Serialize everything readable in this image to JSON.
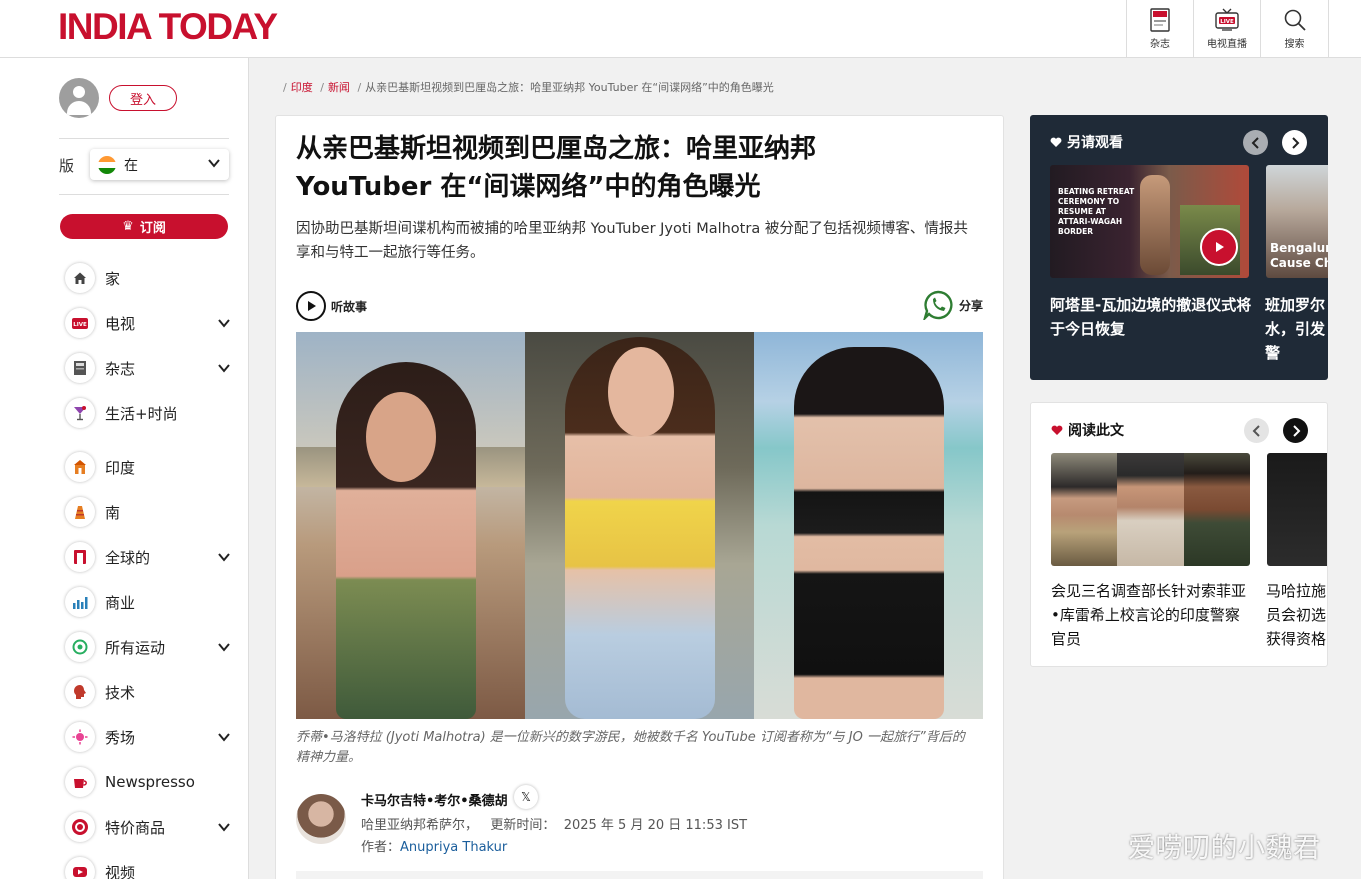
{
  "header": {
    "logo": "INDIA TODAY",
    "buttons": [
      {
        "label": "杂志",
        "icon": "magazine-icon"
      },
      {
        "label": "电视直播",
        "icon": "live-tv-icon"
      },
      {
        "label": "搜索",
        "icon": "search-icon"
      }
    ],
    "magazine_icon_text": "INDIA TODAY",
    "live_badge": "LIVE"
  },
  "sidebar": {
    "login_label": "登入",
    "edition_label": "版",
    "edition_value": "在",
    "subscribe_label": "订阅",
    "nav": [
      {
        "label": "家",
        "icon": "home-icon",
        "expandable": false
      },
      {
        "label": "电视",
        "icon": "live-tv-icon",
        "expandable": true
      },
      {
        "label": "杂志",
        "icon": "magazine-icon",
        "expandable": true
      },
      {
        "label": "生活+时尚",
        "icon": "cocktail-icon",
        "expandable": false
      },
      {
        "label": "印度",
        "icon": "india-icon",
        "expandable": false
      },
      {
        "label": "南",
        "icon": "south-icon",
        "expandable": false
      },
      {
        "label": "全球的",
        "icon": "world-icon",
        "expandable": true
      },
      {
        "label": "商业",
        "icon": "business-chart-icon",
        "expandable": false
      },
      {
        "label": "所有运动",
        "icon": "sports-icon",
        "expandable": true
      },
      {
        "label": "技术",
        "icon": "technology-icon",
        "expandable": false
      },
      {
        "label": "秀场",
        "icon": "showbiz-icon",
        "expandable": true
      },
      {
        "label": "Newspresso",
        "icon": "coffee-cup-icon",
        "expandable": false
      },
      {
        "label": "特价商品",
        "icon": "deals-icon",
        "expandable": true
      },
      {
        "label": "视频",
        "icon": "video-icon",
        "expandable": false
      }
    ]
  },
  "breadcrumb": {
    "items": [
      "印度",
      "新闻"
    ],
    "current": "从亲巴基斯坦视频到巴厘岛之旅：哈里亚纳邦 YouTuber 在“间谍网络”中的角色曝光"
  },
  "article": {
    "title_line1": "从亲巴基斯坦视频到巴厘岛之旅：哈里亚纳邦",
    "title_line2": "YouTuber 在“间谍网络”中的角色曝光",
    "dek": "因协助巴基斯坦间谍机构而被捕的哈里亚纳邦 YouTuber Jyoti Malhotra 被分配了包括视频博客、情报共享和与特工一起旅行等任务。",
    "listen_label": "听故事",
    "share_label": "分享",
    "caption": "乔蒂•马洛特拉 (Jyoti Malhotra) 是一位新兴的数字游民，她被数千名 YouTube 订阅者称为“与 JO 一起旅行”背后的精神力量。",
    "author_name": "卡马尔吉特•考尔•桑德胡",
    "author_social": "𝕏",
    "location": "哈里亚纳邦希萨尔，",
    "updated_label": "更新时间：",
    "updated_value": "2025 年 5 月 20 日 11:53 IST",
    "writer_label": "作者：",
    "writer_name": "Anupriya Thakur"
  },
  "also_watch": {
    "heading": "另请观看",
    "cards": [
      {
        "thumb_text": "BEATING RETREAT CEREMONY TO RESUME AT ATTARI-WAGAH BORDER",
        "title": "阿塔里-瓦加边境的撤退仪式将于今日恢复"
      },
      {
        "thumb_text": "Bengaluru Cause Cha",
        "title": "班加罗尔水，引发警"
      }
    ]
  },
  "read_this": {
    "heading": "阅读此文",
    "cards": [
      {
        "title": "会见三名调查部长针对索菲亚•库雷希上校言论的印度警察官员"
      },
      {
        "title": "马哈拉施员会初选获得资格"
      }
    ]
  },
  "watermark": "爱唠叨的小魏君",
  "colors": {
    "brand_red": "#c8102e",
    "rail_dark": "#1f2a37",
    "link_blue": "#1b5e9c"
  }
}
